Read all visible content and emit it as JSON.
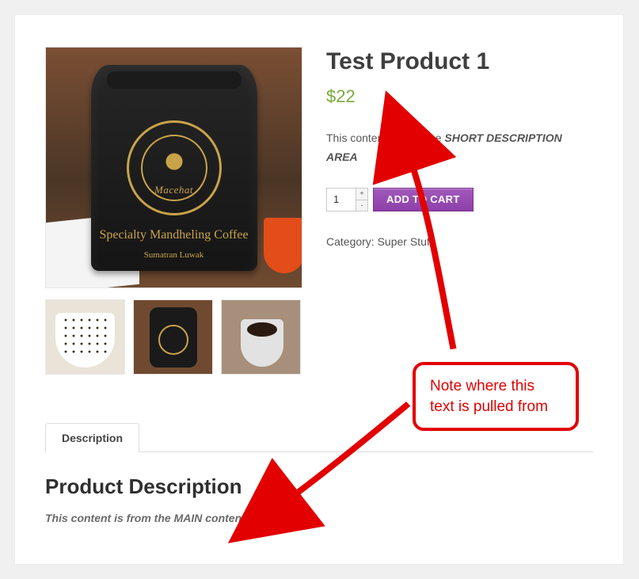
{
  "product": {
    "title": "Test Product 1",
    "price": "$22",
    "short_desc_prefix": "This content is from the ",
    "short_desc_emph": "SHORT DESCRIPTION AREA",
    "qty_value": "1",
    "add_to_cart_label": "ADD TO CART",
    "category_label": "Category: ",
    "category_value": "Super Stuff",
    "category_suffix": ".",
    "bag_brand": "Macehat",
    "bag_tagline": "Specialty Mandheling Coffee",
    "bag_subline": "Sumatran Luwak"
  },
  "tabs": {
    "description_label": "Description"
  },
  "description_panel": {
    "heading": "Product Description",
    "body": "This content is from the MAIN content section."
  },
  "annotation": {
    "line1": "Note where this",
    "line2": "text is pulled from"
  },
  "icons": {
    "plus": "+",
    "minus": "-"
  }
}
